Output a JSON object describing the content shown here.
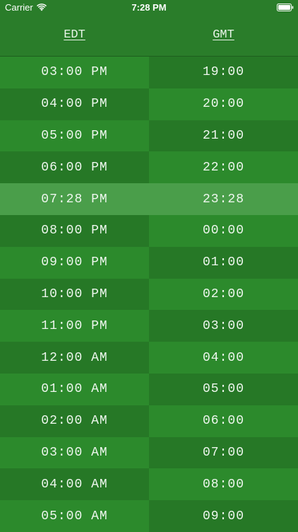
{
  "status_bar": {
    "carrier": "Carrier",
    "time": "7:28 PM"
  },
  "header": {
    "left_label": "EDT",
    "right_label": "GMT"
  },
  "rows": [
    {
      "edt": "03:00 PM",
      "gmt": "19:00"
    },
    {
      "edt": "04:00 PM",
      "gmt": "20:00"
    },
    {
      "edt": "05:00 PM",
      "gmt": "21:00"
    },
    {
      "edt": "06:00 PM",
      "gmt": "22:00"
    },
    {
      "edt": "07:28 PM",
      "gmt": "23:28",
      "current": true
    },
    {
      "edt": "08:00 PM",
      "gmt": "00:00"
    },
    {
      "edt": "09:00 PM",
      "gmt": "01:00"
    },
    {
      "edt": "10:00 PM",
      "gmt": "02:00"
    },
    {
      "edt": "11:00 PM",
      "gmt": "03:00"
    },
    {
      "edt": "12:00 AM",
      "gmt": "04:00"
    },
    {
      "edt": "01:00 AM",
      "gmt": "05:00"
    },
    {
      "edt": "02:00 AM",
      "gmt": "06:00"
    },
    {
      "edt": "03:00 AM",
      "gmt": "07:00"
    },
    {
      "edt": "04:00 AM",
      "gmt": "08:00"
    },
    {
      "edt": "05:00 AM",
      "gmt": "09:00"
    }
  ],
  "colors": {
    "background": "#2a7d2a",
    "row_light": "#2c8a2c",
    "row_dark": "#267826",
    "row_current": "#4a9e4a",
    "text": "#eef7ee"
  }
}
